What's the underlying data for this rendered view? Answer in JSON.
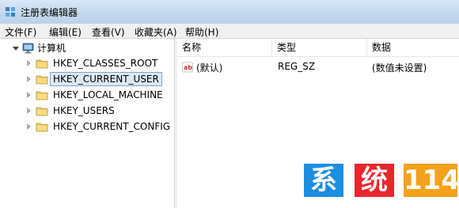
{
  "window": {
    "title": "注册表编辑器"
  },
  "menu": {
    "items": [
      {
        "label": "文件(F)"
      },
      {
        "label": "编辑(E)"
      },
      {
        "label": "查看(V)"
      },
      {
        "label": "收藏夹(A)"
      },
      {
        "label": "帮助(H)"
      }
    ]
  },
  "tree": {
    "root": {
      "label": "计算机",
      "icon": "computer-icon"
    },
    "items": [
      {
        "label": "HKEY_CLASSES_ROOT",
        "selected": false
      },
      {
        "label": "HKEY_CURRENT_USER",
        "selected": true
      },
      {
        "label": "HKEY_LOCAL_MACHINE",
        "selected": false
      },
      {
        "label": "HKEY_USERS",
        "selected": false
      },
      {
        "label": "HKEY_CURRENT_CONFIG",
        "selected": false
      }
    ]
  },
  "list": {
    "columns": [
      {
        "label": "名称"
      },
      {
        "label": "类型"
      },
      {
        "label": "数据"
      }
    ],
    "rows": [
      {
        "name": "(默认)",
        "type": "REG_SZ",
        "data": "(数值未设置)",
        "icon": "string-value-icon"
      }
    ]
  },
  "watermark": {
    "chars": [
      "系",
      "统",
      "114"
    ],
    "colors": {
      "blue": "#1d8ee0",
      "red": "#e8262b",
      "orange": "#f4a11c"
    }
  }
}
